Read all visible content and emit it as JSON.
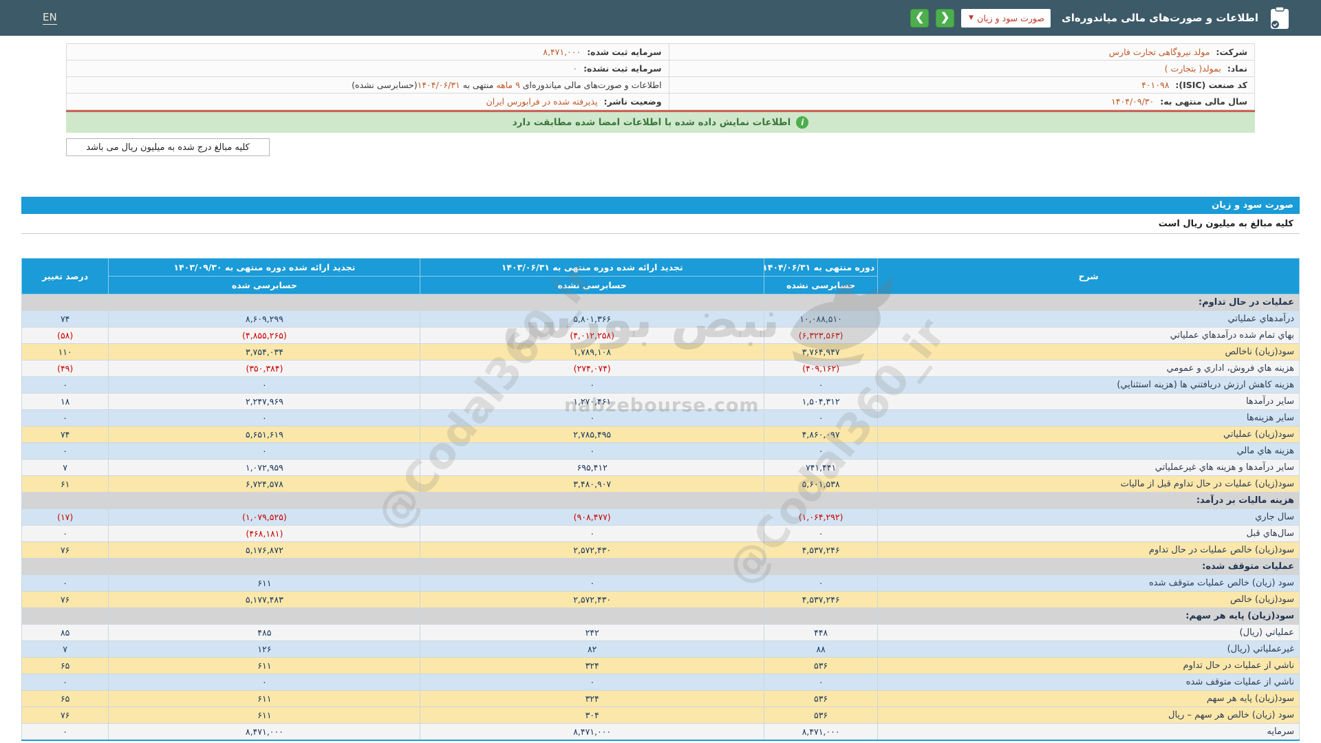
{
  "header": {
    "en_label": "EN",
    "title": "اطلاعات و صورت‌های مالی میاندوره‌ای",
    "dropdown_value": "صورت سود و زیان",
    "dropdown_caret": "▼",
    "nav_next": "❯",
    "nav_prev": "❮"
  },
  "company": {
    "row1": {
      "right_label": "شرکت:",
      "right_value": "مولد نیروگاهی تجارت فارس",
      "left_label": "سرمایه ثبت شده:",
      "left_value": "۸,۴۷۱,۰۰۰"
    },
    "row2": {
      "right_label": "نماد:",
      "right_value": "بمولد( بتجارت )",
      "left_label": "سرمایه ثبت نشده:",
      "left_value": "۰"
    },
    "row3": {
      "right_label": "کد صنعت (ISIC):",
      "right_value": "۴۰۱۰۹۸",
      "left_parts": {
        "p1": "اطلاعات و صورت‌های مالی میاندوره‌ای ",
        "hl1": "۹ ماهه",
        "p2": " منتهی به ",
        "hl2": "۱۴۰۴/۰۶/۳۱",
        "p3": "(حسابرسی نشده)"
      }
    },
    "row4": {
      "right_label": "سال مالی منتهی به:",
      "right_value": "۱۴۰۴/۰۹/۳۰",
      "left_label": "وضعیت ناشر:",
      "left_value": "پذیرفته شده در فرابورس ایران"
    }
  },
  "notice": {
    "text": "اطلاعات نمایش داده شده با اطلاعات امضا شده مطابقت دارد",
    "icon_glyph": "i"
  },
  "amounts_note": "کلیه مبالغ درج شده به میلیون ریال می باشد",
  "statement": {
    "title": "صورت سود و زیان",
    "unit_note": "کلیه مبالغ به میلیون ریال است",
    "columns": {
      "desc": "شرح",
      "col1_line1": "دوره منتهی به ۱۴۰۴/۰۶/۳۱",
      "col1_line2": "حسابرسی نشده",
      "col2_line1": "تجدید ارائه شده دوره منتهی به ۱۴۰۳/۰۶/۳۱",
      "col2_line2": "حسابرسی نشده",
      "col3_line1": "تجدید ارائه شده دوره منتهی به ۱۴۰۳/۰۹/۳۰",
      "col3_line2": "حسابرسی شده",
      "pct": "درصد تغییر"
    },
    "rows": [
      {
        "type": "section",
        "label": "عملیات در حال تداوم:"
      },
      {
        "type": "blue",
        "label": "درآمدهاي عملیاتي",
        "v1": "۱۰,۰۸۸,۵۱۰",
        "v2": "۵,۸۰۱,۳۶۶",
        "v3": "۸,۶۰۹,۲۹۹",
        "pct": "۷۴"
      },
      {
        "type": "white",
        "label": "بهاي تمام شده درآمدهاي عملیاتي",
        "v1": "(۶,۳۲۳,۵۶۳)",
        "v2": "(۴,۰۱۲,۲۵۸)",
        "v3": "(۴,۸۵۵,۲۶۵)",
        "pct": "(۵۸)"
      },
      {
        "type": "yellow",
        "label": "سود(زیان) ناخالص",
        "v1": "۳,۷۶۴,۹۴۷",
        "v2": "۱,۷۸۹,۱۰۸",
        "v3": "۳,۷۵۴,۰۳۴",
        "pct": "۱۱۰"
      },
      {
        "type": "white",
        "label": "هزینه هاي فروش، اداري و عمومي",
        "v1": "(۴۰۹,۱۶۲)",
        "v2": "(۲۷۴,۰۷۴)",
        "v3": "(۳۵۰,۳۸۴)",
        "pct": "(۴۹)"
      },
      {
        "type": "blue",
        "label": "هزینه کاهش ارزش دریافتني ها (هزینه استثنایي)",
        "v1": "۰",
        "v2": "۰",
        "v3": "۰",
        "pct": "۰"
      },
      {
        "type": "white",
        "label": "سایر درآمدها",
        "v1": "۱,۵۰۴,۳۱۲",
        "v2": "۱,۲۷۰,۴۶۱",
        "v3": "۲,۲۴۷,۹۶۹",
        "pct": "۱۸"
      },
      {
        "type": "blue",
        "label": "سایر هزینه‌ها",
        "v1": "۰",
        "v2": "۰",
        "v3": "۰",
        "pct": "۰"
      },
      {
        "type": "yellow",
        "label": "سود(زیان) عملیاتي",
        "v1": "۴,۸۶۰,۰۹۷",
        "v2": "۲,۷۸۵,۴۹۵",
        "v3": "۵,۶۵۱,۶۱۹",
        "pct": "۷۴"
      },
      {
        "type": "blue",
        "label": "هزینه هاي مالي",
        "v1": "۰",
        "v2": "۰",
        "v3": "۰",
        "pct": "۰"
      },
      {
        "type": "white",
        "label": "سایر درآمدها و هزینه هاي غیرعملیاتي",
        "v1": "۷۴۱,۴۴۱",
        "v2": "۶۹۵,۴۱۲",
        "v3": "۱,۰۷۲,۹۵۹",
        "pct": "۷"
      },
      {
        "type": "yellow",
        "label": "سود(زیان) عملیات در حال تداوم قبل از مالیات",
        "v1": "۵,۶۰۱,۵۳۸",
        "v2": "۳,۴۸۰,۹۰۷",
        "v3": "۶,۷۲۴,۵۷۸",
        "pct": "۶۱"
      },
      {
        "type": "section",
        "label": "هزینه مالیات بر درآمد:"
      },
      {
        "type": "blue",
        "label": "سال جاري",
        "v1": "(۱,۰۶۴,۲۹۲)",
        "v2": "(۹۰۸,۴۷۷)",
        "v3": "(۱,۰۷۹,۵۲۵)",
        "pct": "(۱۷)"
      },
      {
        "type": "white",
        "label": "سال‌هاي قبل",
        "v1": "۰",
        "v2": "۰",
        "v3": "(۴۶۸,۱۸۱)",
        "pct": "۰"
      },
      {
        "type": "yellow",
        "label": "سود(زیان) خالص عملیات در حال تداوم",
        "v1": "۴,۵۳۷,۲۴۶",
        "v2": "۲,۵۷۲,۴۳۰",
        "v3": "۵,۱۷۶,۸۷۲",
        "pct": "۷۶"
      },
      {
        "type": "section",
        "label": "عملیات متوقف شده:"
      },
      {
        "type": "blue",
        "label": "سود (زیان) خالص عملیات متوقف شده",
        "v1": "۰",
        "v2": "۰",
        "v3": "۶۱۱",
        "pct": "۰"
      },
      {
        "type": "yellow",
        "label": "سود(زیان) خالص",
        "v1": "۴,۵۳۷,۲۴۶",
        "v2": "۲,۵۷۲,۴۳۰",
        "v3": "۵,۱۷۷,۴۸۳",
        "pct": "۷۶"
      },
      {
        "type": "section",
        "label": "سود(زیان) پایه هر سهم:"
      },
      {
        "type": "white",
        "label": "عملیاتي (ریال)",
        "v1": "۴۴۸",
        "v2": "۲۴۲",
        "v3": "۴۸۵",
        "pct": "۸۵"
      },
      {
        "type": "blue",
        "label": "غیرعملیاتي (ریال)",
        "v1": "۸۸",
        "v2": "۸۲",
        "v3": "۱۲۶",
        "pct": "۷"
      },
      {
        "type": "yellow",
        "label": "ناشي از عملیات در حال تداوم",
        "v1": "۵۳۶",
        "v2": "۳۲۴",
        "v3": "۶۱۱",
        "pct": "۶۵"
      },
      {
        "type": "blue",
        "label": "ناشي از عملیات متوقف شده",
        "v1": "۰",
        "v2": "۰",
        "v3": "۰",
        "pct": "۰"
      },
      {
        "type": "yellow",
        "label": "سود(زیان) پایه هر سهم",
        "v1": "۵۳۶",
        "v2": "۳۲۴",
        "v3": "۶۱۱",
        "pct": "۶۵"
      },
      {
        "type": "yellow",
        "label": "سود (زیان) خالص هر سهم – ریال",
        "v1": "۵۳۶",
        "v2": "۳۰۴",
        "v3": "۶۱۱",
        "pct": "۷۶"
      },
      {
        "type": "white",
        "label": "سرمایه",
        "v1": "۸,۴۷۱,۰۰۰",
        "v2": "۸,۴۷۱,۰۰۰",
        "v3": "۸,۴۷۱,۰۰۰",
        "pct": "۰"
      }
    ]
  },
  "watermark": {
    "brand_fa": "نبض بورس",
    "brand_domain": "nabzebourse.com",
    "handle": "@Codal360_ir"
  },
  "colors": {
    "header_bar": "#3d5a68",
    "accent_blue": "#1b9bd7",
    "green_button": "#4cae4c",
    "notice_green_bg": "#cfe8cb",
    "notice_green_text": "#3c763d",
    "red_divider": "#ca6458",
    "value_orange": "#c05b2b",
    "dropdown_text_red": "#c0392b",
    "row_blue": "#d2e4f3",
    "row_yellow": "#fbe7a9",
    "row_white": "#f4f4f4",
    "section_gray": "#d4d4d4",
    "positive_number": "#17365d",
    "negative_number": "#cc0000"
  }
}
